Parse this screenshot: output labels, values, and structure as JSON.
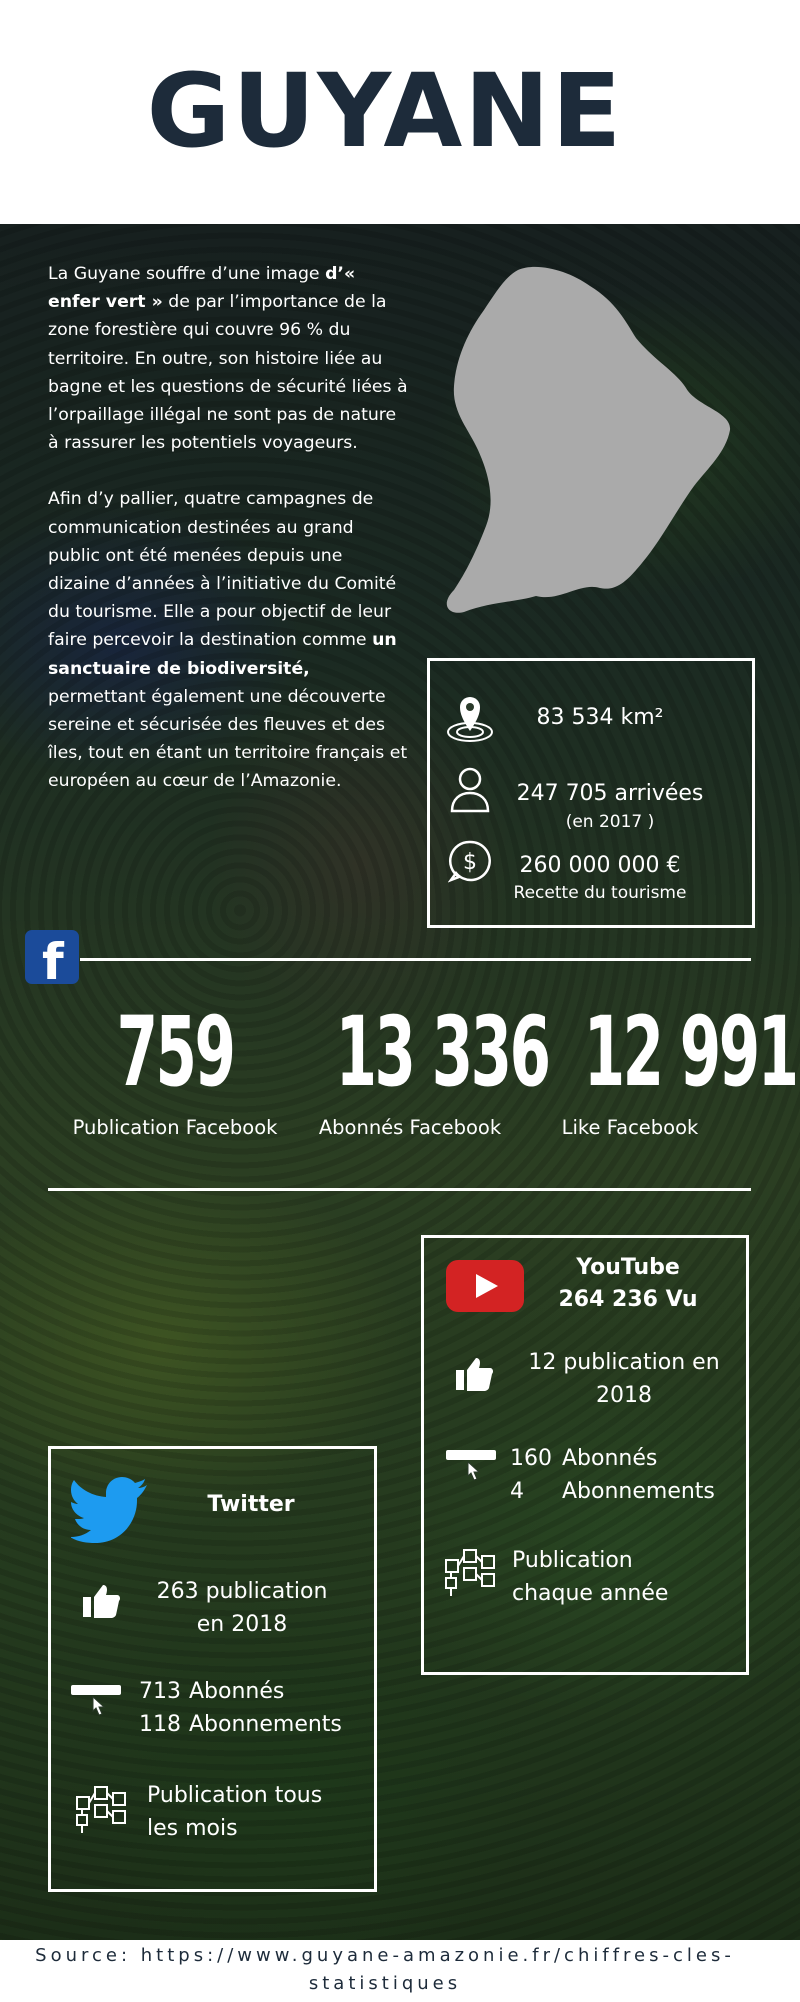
{
  "title": "GUYANE",
  "intro": {
    "p1_a": "La Guyane souffre d’une image ",
    "p1_b": " d’« enfer vert »",
    "p1_c": " de par l’importance de la zone forestière qui couvre 96 % du territoire. En outre, son histoire liée au bagne et les questions de sécurité liées à l’orpaillage illégal ne sont pas de nature à rassurer les potentiels voyageurs.",
    "p2_a": "Afin d’y pallier, quatre campagnes de communication destinées au grand public ont été menées depuis une dizaine d’années à l’initiative du Comité du tourisme. Elle a pour objectif de leur faire percevoir la destination comme ",
    "p2_b": "un sanctuaire de biodiversité,",
    "p2_c": " permettant également une découverte sereine et sécurisée des fleuves et des îles, tout en étant un territoire français et européen au cœur de l’Amazonie."
  },
  "stats": {
    "area": "83 534 km²",
    "arrivals": "247 705 arrivées",
    "arrivals_note": "(en 2017 )",
    "revenue": "260 000 000 €",
    "revenue_note": "Recette du tourisme"
  },
  "facebook": {
    "icon_letter": "f",
    "metrics": [
      {
        "value": "759",
        "label": "Publication Facebook"
      },
      {
        "value": "13 336",
        "label": "Abonnés Facebook"
      },
      {
        "value": "12 991",
        "label": "Like Facebook"
      }
    ]
  },
  "youtube": {
    "title": "YouTube",
    "views": "264 236 Vu",
    "publications_line1": "12 publication en",
    "publications_line2": "2018",
    "subscribers_count": "160",
    "subscribers_label": "Abonnés",
    "subscriptions_count": "4",
    "subscriptions_label": "Abonnements",
    "frequency_line1": "Publication",
    "frequency_line2": "chaque année"
  },
  "twitter": {
    "title": "Twitter",
    "publications_line1": "263 publication",
    "publications_line2": "en 2018",
    "followers_count": "713",
    "followers_label": "Abonnés",
    "following_count": "118",
    "following_label": "Abonnements",
    "frequency_line1": "Publication tous",
    "frequency_line2": "les  mois"
  },
  "source": {
    "line1": "Source: https://www.guyane-amazonie.fr/chiffres-cles-",
    "line2": "statistiques"
  },
  "colors": {
    "title": "#1d2b3a",
    "facebook": "#1b4b9a",
    "youtube": "#d32323",
    "twitter": "#1d9bf0",
    "map": "#aaaaaa"
  }
}
